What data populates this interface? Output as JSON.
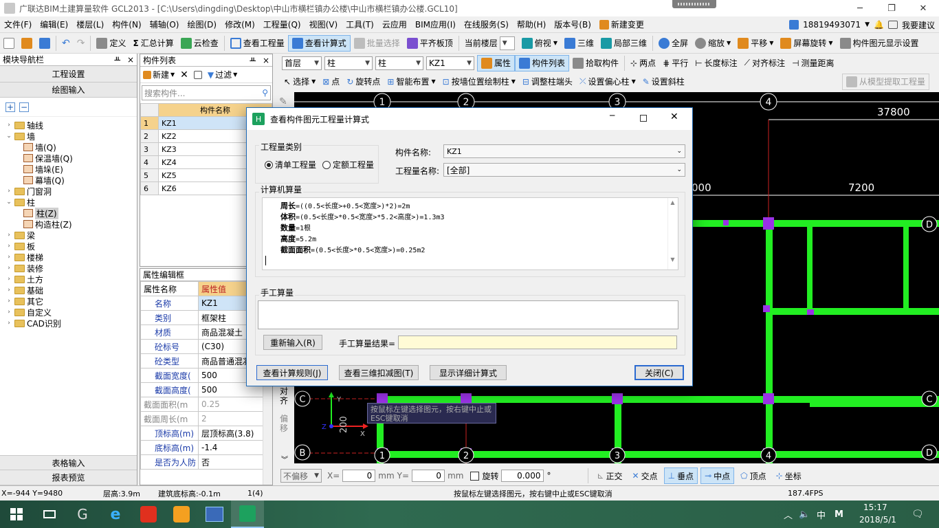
{
  "window": {
    "title": "广联达BIM土建算量软件 GCL2013 - [C:\\Users\\dingding\\Desktop\\中山市横栏镇办公楼\\中山市横栏镇办公楼.GCL10]",
    "min": "─",
    "max": "❐",
    "close": "✕"
  },
  "menu": [
    "文件(F)",
    "编辑(E)",
    "楼层(L)",
    "构件(N)",
    "辅轴(O)",
    "绘图(D)",
    "修改(M)",
    "工程量(Q)",
    "视图(V)",
    "工具(T)",
    "云应用",
    "BIM应用(I)",
    "在线服务(S)",
    "帮助(H)",
    "版本号(B)"
  ],
  "menu_new_change": "新建变更",
  "account": {
    "phone": "18819493071",
    "feedback": "我要建议"
  },
  "toolbar1": {
    "define": "定义",
    "sum": "汇总计算",
    "cloud_check": "云检查",
    "view_qty": "查看工程量",
    "view_formula": "查看计算式",
    "batch_select": "批量选择",
    "flat_slab": "平齐板顶",
    "current_floor": "当前楼层",
    "top_view": "俯视",
    "three_d": "三维",
    "local_3d": "局部三维",
    "fullscreen": "全屏",
    "zoom": "缩放",
    "pan": "平移",
    "rotate_screen": "屏幕旋转",
    "display_settings": "构件图元显示设置"
  },
  "nav": {
    "header": "模块导航栏",
    "btn_project": "工程设置",
    "btn_draw": "绘图输入",
    "tree": [
      {
        "label": "轴线",
        "level": 0,
        "open": false
      },
      {
        "label": "墙",
        "level": 0,
        "open": true
      },
      {
        "label": "墙(Q)",
        "level": 1
      },
      {
        "label": "保温墙(Q)",
        "level": 1
      },
      {
        "label": "墙垛(E)",
        "level": 1
      },
      {
        "label": "幕墙(Q)",
        "level": 1
      },
      {
        "label": "门窗洞",
        "level": 0,
        "open": false
      },
      {
        "label": "柱",
        "level": 0,
        "open": true
      },
      {
        "label": "柱(Z)",
        "level": 1,
        "selected": true
      },
      {
        "label": "构造柱(Z)",
        "level": 1
      },
      {
        "label": "梁",
        "level": 0,
        "open": false
      },
      {
        "label": "板",
        "level": 0,
        "open": false
      },
      {
        "label": "楼梯",
        "level": 0,
        "open": false
      },
      {
        "label": "装修",
        "level": 0,
        "open": false
      },
      {
        "label": "土方",
        "level": 0,
        "open": false
      },
      {
        "label": "基础",
        "level": 0,
        "open": false
      },
      {
        "label": "其它",
        "level": 0,
        "open": false
      },
      {
        "label": "自定义",
        "level": 0,
        "open": false
      },
      {
        "label": "CAD识别",
        "level": 0,
        "open": false
      }
    ],
    "btn_table": "表格输入",
    "btn_report": "报表预览"
  },
  "complist": {
    "header": "构件列表",
    "new": "新建",
    "filter": "过滤",
    "search_placeholder": "搜索构件...",
    "col": "构件名称",
    "rows": [
      [
        "1",
        "KZ1"
      ],
      [
        "2",
        "KZ2"
      ],
      [
        "3",
        "KZ3"
      ],
      [
        "4",
        "KZ4"
      ],
      [
        "5",
        "KZ5"
      ],
      [
        "6",
        "KZ6"
      ]
    ]
  },
  "props": {
    "header": "属性编辑框",
    "col_name": "属性名称",
    "col_val": "属性值",
    "rows": [
      [
        "名称",
        "KZ1"
      ],
      [
        "类别",
        "框架柱"
      ],
      [
        "材质",
        "商品混凝土"
      ],
      [
        "砼标号",
        "(C30)"
      ],
      [
        "砼类型",
        "商品普通混凝"
      ],
      [
        "截面宽度(",
        "500"
      ],
      [
        "截面高度(",
        "500"
      ],
      [
        "截面面积(m",
        "0.25"
      ],
      [
        "截面周长(m",
        "2"
      ],
      [
        "顶标高(m)",
        "层顶标高(3.8)"
      ],
      [
        "底标高(m)",
        "-1.4"
      ],
      [
        "是否为人防",
        "否"
      ]
    ]
  },
  "drawbar": {
    "floor": "首层",
    "type1": "柱",
    "type2": "柱",
    "comp": "KZ1",
    "attr": "属性",
    "comp_list": "构件列表",
    "pick": "拾取构件",
    "two_point": "两点",
    "parallel": "平行",
    "len_mark": "长度标注",
    "align_mark": "对齐标注",
    "measure": "测量距离",
    "select": "选择",
    "point": "点",
    "rotate_point": "旋转点",
    "smart_place": "智能布置",
    "by_axis": "按墙位置绘制柱",
    "adjust_head": "调整柱端头",
    "set_offset": "设置偏心柱",
    "set_slope": "设置斜柱",
    "extract": "从模型提取工程量"
  },
  "canvas": {
    "axes_top": [
      "1",
      "2",
      "3",
      "4"
    ],
    "dim_37800": "37800",
    "dim_000": "000",
    "dim_7200": "7200",
    "label_c": "C",
    "label_b": "B",
    "label_d": "D",
    "dim_200": "200",
    "ucs_x": "X",
    "ucs_y": "Y",
    "ucs_z": "Z",
    "v_align": "对齐",
    "v_offset": "偏移",
    "tooltip": "按鼠标左键选择图元，按右键中止或ESC键取消"
  },
  "snap": {
    "no_offset": "不偏移",
    "x_label": "X=",
    "x_val": "0",
    "unit_mm": "mm",
    "y_label": "Y=",
    "y_val": "0",
    "unit_mm2": "mm",
    "rotate": "旋转",
    "rot_val": "0.000",
    "deg": "°",
    "orth": "正交",
    "intersect": "交点",
    "perp": "垂点",
    "mid": "中点",
    "vertex": "顶点",
    "coord": "坐标"
  },
  "status": {
    "xy": "X=-944 Y=9480",
    "floor_h": "层高:3.9m",
    "base_el": "建筑底标高:-0.1m",
    "count": "1(4)",
    "hint": "按鼠标左键选择图元，按右键中止或ESC键取消",
    "fps": "187.4FPS"
  },
  "dialog": {
    "title": "查看构件图元工程量计算式",
    "grp_type": "工程量类别",
    "radio_list": "清单工程量",
    "radio_quota": "定额工程量",
    "comp_label": "构件名称:",
    "comp_val": "KZ1",
    "qty_label": "工程量名称:",
    "qty_val": "[全部]",
    "grp_computer": "计算机算量",
    "formulas": [
      {
        "name": "周长",
        "expr": "=((0.5<长度>+0.5<宽度>)*2)=2m"
      },
      {
        "name": "体积",
        "expr": "=(0.5<长度>*0.5<宽度>*5.2<高度>)=1.3m3"
      },
      {
        "name": "数量",
        "expr": "=1根"
      },
      {
        "name": "高度",
        "expr": "=5.2m"
      },
      {
        "name": "截面面积",
        "expr": "=(0.5<长度>*0.5<宽度>)=0.25m2"
      }
    ],
    "grp_manual": "手工算量",
    "reinput": "重新输入(R)",
    "manual_result": "手工算量结果=",
    "btn_rules": "查看计算规则(J)",
    "btn_3d": "查看三维扣减图(T)",
    "btn_detail": "显示详细计算式",
    "btn_close": "关闭(C)"
  },
  "taskbar": {
    "ime": "中",
    "ime2": "M",
    "time": "15:17",
    "date": "2018/5/1"
  }
}
